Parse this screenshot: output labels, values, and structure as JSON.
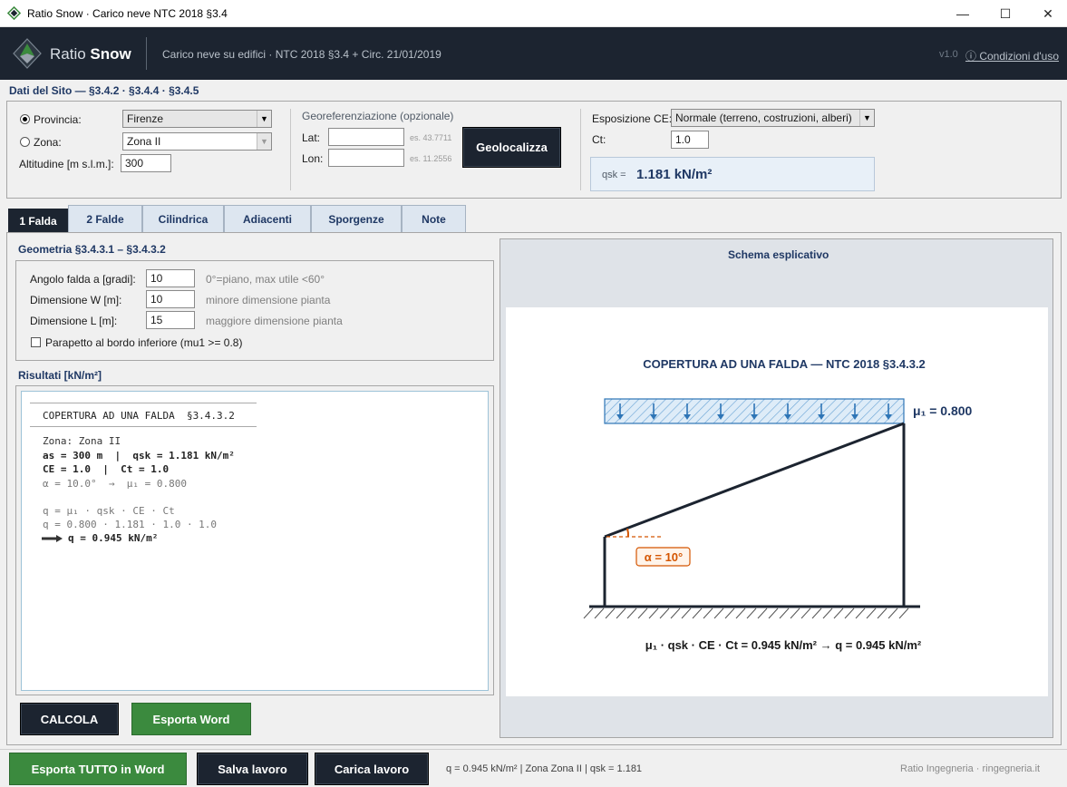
{
  "window": {
    "title": "Ratio Snow  ·  Carico neve NTC 2018 §3.4",
    "minimize": "—",
    "maximize": "☐",
    "close": "✕"
  },
  "header": {
    "brand_light": "Ratio ",
    "brand_bold": "Snow",
    "subtitle": "Carico neve su edifici  ·  NTC 2018 §3.4  +  Circ. 21/01/2019",
    "version": "v1.0",
    "terms": "ⓘ Condizioni d'uso"
  },
  "site": {
    "title": "Dati del Sito  —  §3.4.2 · §3.4.4 · §3.4.5",
    "provincia_label": "Provincia:",
    "provincia_value": "Firenze",
    "zona_label": "Zona:",
    "zona_value": "Zona II",
    "altitude_label": "Altitudine [m s.l.m.]:",
    "altitude_value": "300",
    "geo_title": "Georeferenziazione (opzionale)",
    "lat_label": "Lat:",
    "lat_value": "",
    "lat_hint": "es. 43.7711",
    "lon_label": "Lon:",
    "lon_value": "",
    "lon_hint": "es. 11.2556",
    "geolocate": "Geolocalizza",
    "exposure_label": "Esposizione CE:",
    "exposure_value": "Normale  (terreno, costruzioni, alberi)",
    "ct_label": "Ct:",
    "ct_value": "1.0",
    "qsk_label": "qsk =",
    "qsk_value": "1.181 kN/m²"
  },
  "tabs": [
    "1 Falda",
    "2 Falde",
    "Cilindrica",
    "Adiacenti",
    "Sporgenze",
    "Note"
  ],
  "geometry": {
    "title": "Geometria  §3.4.3.1 – §3.4.3.2",
    "angle_label": "Angolo falda a [gradi]:",
    "angle_value": "10",
    "angle_hint": "0°=piano, max utile <60°",
    "w_label": "Dimensione W [m]:",
    "w_value": "10",
    "w_hint": "minore dimensione pianta",
    "l_label": "Dimensione L [m]:",
    "l_value": "15",
    "l_hint": "maggiore dimensione pianta",
    "parapet_label": "Parapetto al bordo inferiore (mu1 >= 0.8)"
  },
  "results": {
    "title": "Risultati [kN/m²]",
    "heading": "COPERTURA AD UNA FALDA  §3.4.3.2",
    "l1": "Zona: Zona II",
    "l2": "as = 300 m  |  qsk = 1.181 kN/m²",
    "l3": "CE = 1.0  |  Ct = 1.0",
    "l4": "α = 10.0°  →  μ₁ = 0.800",
    "l5": "q = μ₁ · qsk · CE · Ct",
    "l6": "q = 0.800 · 1.181 · 1.0 · 1.0",
    "l7": "q = 0.945 kN/m²"
  },
  "buttons": {
    "calcola": "CALCOLA",
    "export_word": "Esporta Word",
    "export_all": "Esporta TUTTO in Word",
    "save": "Salva lavoro",
    "load": "Carica lavoro"
  },
  "schema": {
    "title": "Schema esplicativo",
    "diagram_title": "COPERTURA AD UNA FALDA  —  NTC 2018 §3.4.3.2",
    "mu_label": "μ₁ = 0.800",
    "angle_label": "α = 10°",
    "formula": "μ₁ · qsk · CE · Ct = 0.945 kN/m²  →  q = 0.945 kN/m²"
  },
  "status": {
    "summary": "q = 0.945 kN/m²  |  Zona Zona II  |  qsk = 1.181",
    "credit": "Ratio Ingegneria  ·  ringegneria.it"
  },
  "colors": {
    "dark": "#1c2430",
    "green": "#3b8a3e",
    "navy": "#1f3864",
    "orange": "#d45500",
    "snow_blue": "#2e75b6"
  }
}
